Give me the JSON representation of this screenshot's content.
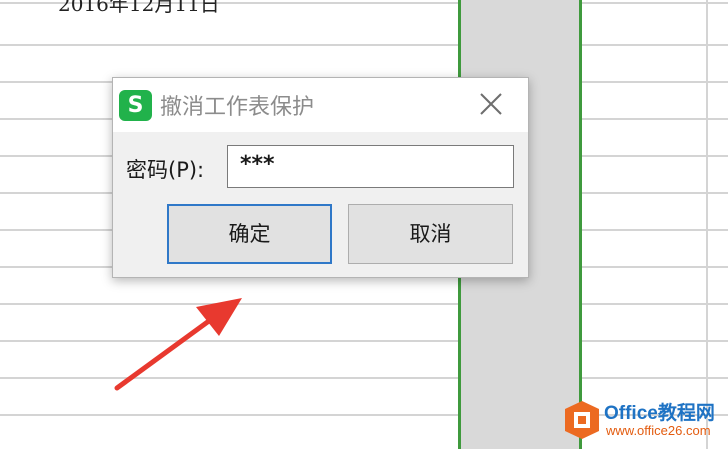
{
  "sheet": {
    "partial_cell_text": "2016年12月11日"
  },
  "dialog": {
    "icon_letter": "S",
    "title": "撤消工作表保护",
    "password_label": "密码(P):",
    "password_value": "***",
    "ok_label": "确定",
    "cancel_label": "取消"
  },
  "watermark": {
    "title": "Office教程网",
    "url": "www.office26.com"
  },
  "colors": {
    "selection_border": "#3f9a3d",
    "app_icon": "#21b24b",
    "default_button_border": "#2f78c8",
    "annotation_arrow": "#e8392f"
  }
}
